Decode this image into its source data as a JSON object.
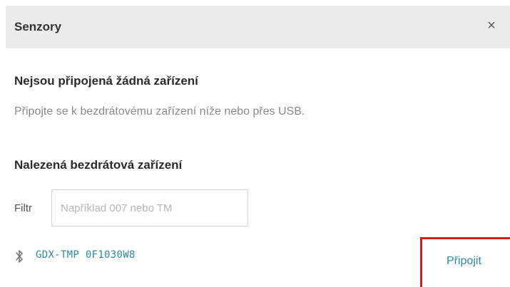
{
  "dialog": {
    "title": "Senzory",
    "close_label": "×"
  },
  "connected": {
    "heading": "Nejsou připojená žádná zařízení",
    "description": "Připojte se k bezdrátovému zařízení níže nebo přes USB."
  },
  "wireless": {
    "heading": "Nalezená bezdrátová zařízení",
    "filter_label": "Filtr",
    "filter_value": "",
    "filter_placeholder": "Například 007 nebo TM",
    "devices": [
      {
        "icon": "bluetooth-icon",
        "name": "GDX-TMP 0F1030W8",
        "action_label": "Připojit"
      }
    ]
  },
  "colors": {
    "header_bg": "#ebebeb",
    "device_name": "#2a8a9e",
    "connect_text": "#2b8ba3",
    "highlight_border": "#e01818"
  }
}
